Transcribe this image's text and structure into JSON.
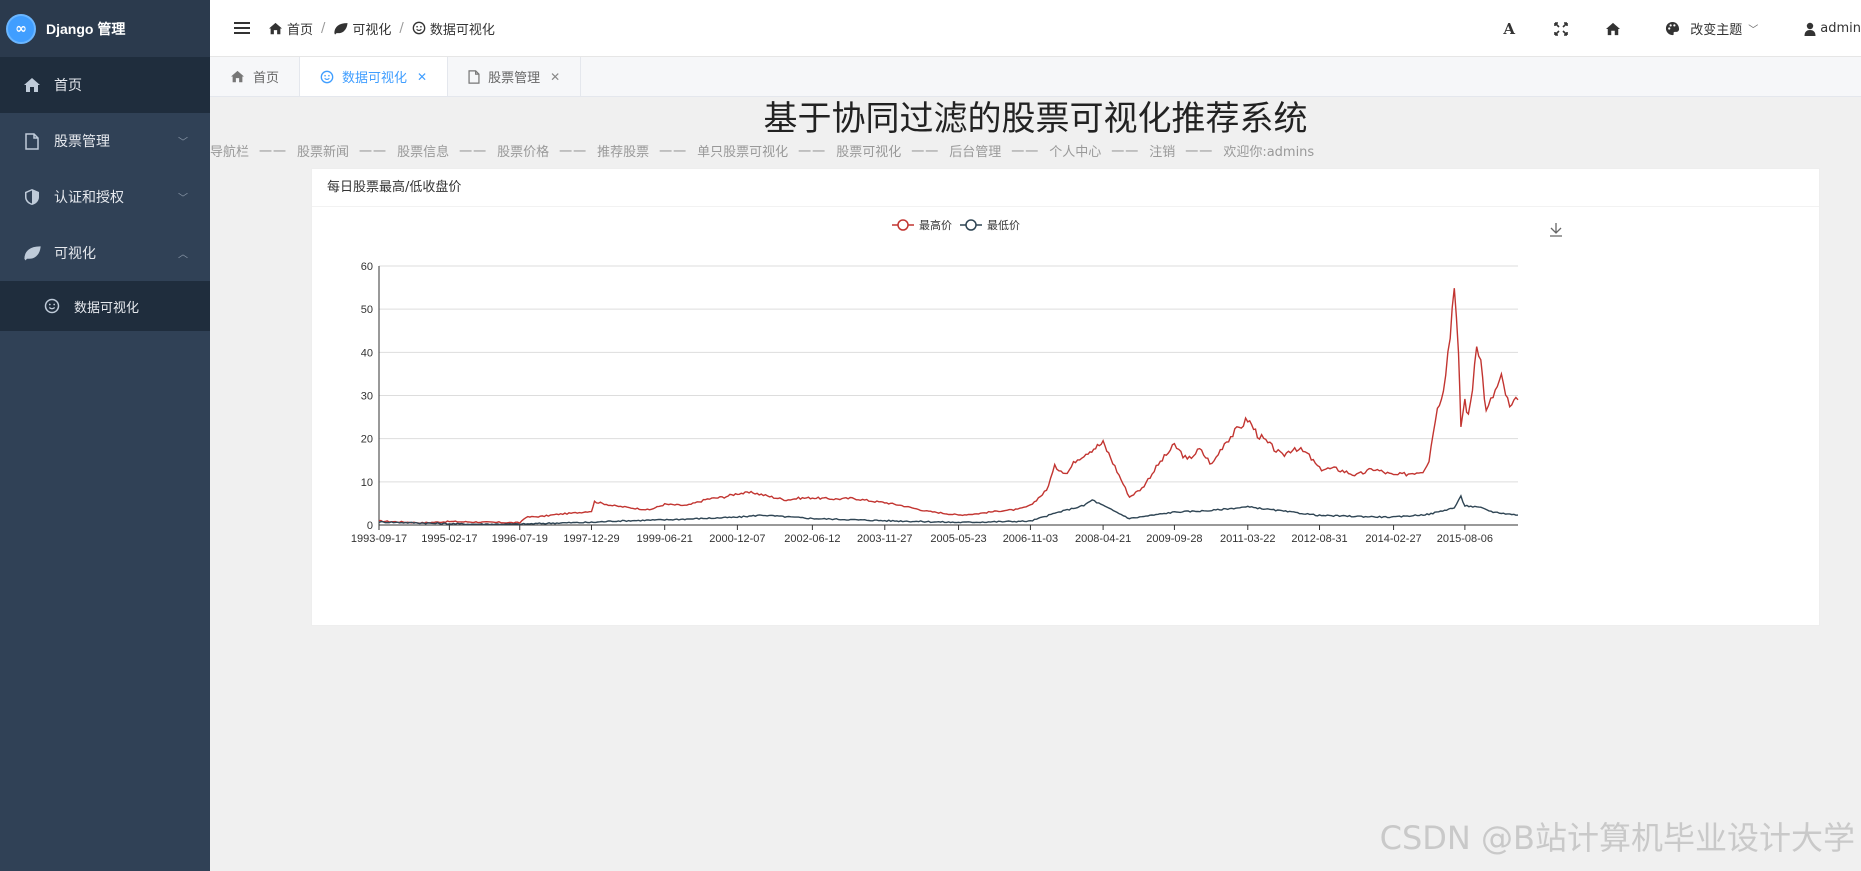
{
  "app": {
    "brand_title": "Django 管理",
    "logo_icon": "infinity-logo-icon"
  },
  "sidebar": {
    "items": [
      {
        "label": "首页",
        "icon": "home-icon"
      },
      {
        "label": "股票管理",
        "icon": "file-icon"
      },
      {
        "label": "认证和授权",
        "icon": "shield-icon"
      },
      {
        "label": "可视化",
        "icon": "leaf-icon"
      }
    ],
    "subitems": [
      {
        "label": "数据可视化",
        "icon": "smile-icon"
      }
    ]
  },
  "header": {
    "breadcrumb": [
      {
        "label": "首页",
        "icon": "home-icon"
      },
      {
        "label": "可视化",
        "icon": "leaf-icon"
      },
      {
        "label": "数据可视化",
        "icon": "smile-icon"
      }
    ],
    "theme_label": "改变主题",
    "user_label": "admin"
  },
  "tabs": [
    {
      "label": "首页",
      "icon": "home-icon"
    },
    {
      "label": "数据可视化",
      "icon": "smile-icon",
      "active": true
    },
    {
      "label": "股票管理",
      "icon": "file-icon"
    }
  ],
  "page": {
    "title": "基于协同过滤的股票可视化推荐系统",
    "nav_links": [
      "导航栏",
      "股票新闻",
      "股票信息",
      "股票价格",
      "推荐股票",
      "单只股票可视化",
      "股票可视化",
      "后台管理",
      "个人中心",
      "注销",
      "欢迎你:admins"
    ],
    "nav_separator": "一一",
    "card_title": "每日股票最高/低收盘价",
    "watermark": "CSDN @B站计算机毕业设计大学"
  },
  "chart_data": {
    "type": "line",
    "title": "",
    "xlabel": "",
    "ylabel": "",
    "ylim": [
      0,
      60
    ],
    "yticks": [
      0,
      10,
      20,
      30,
      40,
      50,
      60
    ],
    "grid": true,
    "legend_position": "top-center",
    "x_tick_labels": [
      "1993-09-17",
      "1995-02-17",
      "1996-07-19",
      "1997-12-29",
      "1999-06-21",
      "2000-12-07",
      "2002-06-12",
      "2003-11-27",
      "2005-05-23",
      "2006-11-03",
      "2008-04-21",
      "2009-09-28",
      "2011-03-22",
      "2012-08-31",
      "2014-02-27",
      "2015-08-06"
    ],
    "x_range": [
      "1993-09-17",
      "2016-08-31"
    ],
    "series": [
      {
        "name": "最高价",
        "color": "#c23531",
        "points": [
          [
            "1993-09-17",
            0.9
          ],
          [
            "1994-03-01",
            0.7
          ],
          [
            "1994-08-01",
            0.5
          ],
          [
            "1995-02-17",
            0.8
          ],
          [
            "1995-08-01",
            0.7
          ],
          [
            "1996-02-01",
            0.6
          ],
          [
            "1996-07-19",
            0.5
          ],
          [
            "1996-09-01",
            1.8
          ],
          [
            "1997-01-01",
            2.0
          ],
          [
            "1997-05-01",
            2.5
          ],
          [
            "1997-09-01",
            2.8
          ],
          [
            "1997-12-29",
            3.2
          ],
          [
            "1998-01-20",
            5.4
          ],
          [
            "1998-06-01",
            4.5
          ],
          [
            "1998-12-01",
            3.8
          ],
          [
            "1999-03-01",
            3.5
          ],
          [
            "1999-06-21",
            4.8
          ],
          [
            "1999-12-01",
            4.5
          ],
          [
            "2000-05-01",
            6.0
          ],
          [
            "2000-09-01",
            6.5
          ],
          [
            "2000-12-07",
            7.3
          ],
          [
            "2001-04-01",
            7.5
          ],
          [
            "2001-08-01",
            6.6
          ],
          [
            "2001-12-01",
            5.8
          ],
          [
            "2002-03-01",
            6.2
          ],
          [
            "2002-06-12",
            6.3
          ],
          [
            "2002-12-01",
            6.0
          ],
          [
            "2003-04-01",
            6.2
          ],
          [
            "2003-09-01",
            5.5
          ],
          [
            "2003-11-27",
            5.2
          ],
          [
            "2004-04-01",
            4.5
          ],
          [
            "2004-10-01",
            3.2
          ],
          [
            "2005-05-23",
            2.3
          ],
          [
            "2005-10-01",
            2.6
          ],
          [
            "2006-03-01",
            3.2
          ],
          [
            "2006-08-01",
            3.6
          ],
          [
            "2006-11-03",
            4.5
          ],
          [
            "2007-03-01",
            8.0
          ],
          [
            "2007-05-01",
            13.5
          ],
          [
            "2007-08-01",
            12.0
          ],
          [
            "2007-10-01",
            15.0
          ],
          [
            "2008-01-01",
            17.0
          ],
          [
            "2008-04-21",
            19.0
          ],
          [
            "2008-06-01",
            16.5
          ],
          [
            "2008-09-01",
            10.5
          ],
          [
            "2008-11-01",
            6.5
          ],
          [
            "2009-02-01",
            8.5
          ],
          [
            "2009-06-01",
            14.0
          ],
          [
            "2009-09-28",
            18.5
          ],
          [
            "2010-01-01",
            15.0
          ],
          [
            "2010-04-01",
            17.5
          ],
          [
            "2010-07-01",
            14.0
          ],
          [
            "2010-10-01",
            19.0
          ],
          [
            "2011-01-01",
            22.0
          ],
          [
            "2011-03-22",
            24.5
          ],
          [
            "2011-06-01",
            21.0
          ],
          [
            "2011-09-01",
            18.5
          ],
          [
            "2011-12-01",
            16.0
          ],
          [
            "2012-03-01",
            18.0
          ],
          [
            "2012-06-01",
            16.5
          ],
          [
            "2012-08-31",
            13.0
          ],
          [
            "2013-01-01",
            13.0
          ],
          [
            "2013-06-01",
            11.5
          ],
          [
            "2013-10-01",
            13.0
          ],
          [
            "2014-02-27",
            11.5
          ],
          [
            "2014-06-01",
            11.8
          ],
          [
            "2014-10-01",
            12.5
          ],
          [
            "2014-11-15",
            15.0
          ],
          [
            "2015-01-01",
            25.0
          ],
          [
            "2015-03-01",
            32.0
          ],
          [
            "2015-04-20",
            44.0
          ],
          [
            "2015-05-20",
            57.0
          ],
          [
            "2015-06-20",
            39.0
          ],
          [
            "2015-07-08",
            23.0
          ],
          [
            "2015-08-06",
            29.0
          ],
          [
            "2015-09-01",
            25.0
          ],
          [
            "2015-10-01",
            32.0
          ],
          [
            "2015-11-01",
            43.0
          ],
          [
            "2015-12-01",
            38.0
          ],
          [
            "2016-01-10",
            26.0
          ],
          [
            "2016-03-01",
            30.0
          ],
          [
            "2016-05-01",
            34.0
          ],
          [
            "2016-07-01",
            27.0
          ],
          [
            "2016-08-31",
            29.0
          ]
        ]
      },
      {
        "name": "最低价",
        "color": "#2f4554",
        "points": [
          [
            "1993-09-17",
            0.7
          ],
          [
            "1994-06-01",
            0.5
          ],
          [
            "1995-02-17",
            0.3
          ],
          [
            "1995-08-01",
            0.2
          ],
          [
            "1996-07-19",
            0.2
          ],
          [
            "1997-06-01",
            0.5
          ],
          [
            "1997-12-29",
            0.6
          ],
          [
            "1998-06-01",
            0.9
          ],
          [
            "1999-06-21",
            1.2
          ],
          [
            "2000-12-07",
            1.8
          ],
          [
            "2001-06-01",
            2.3
          ],
          [
            "2002-06-12",
            1.5
          ],
          [
            "2003-11-27",
            1.0
          ],
          [
            "2005-05-23",
            0.6
          ],
          [
            "2006-11-03",
            0.9
          ],
          [
            "2007-06-01",
            3.0
          ],
          [
            "2007-12-01",
            4.5
          ],
          [
            "2008-02-01",
            5.8
          ],
          [
            "2008-04-21",
            4.5
          ],
          [
            "2008-11-01",
            1.5
          ],
          [
            "2009-09-28",
            3.0
          ],
          [
            "2010-06-01",
            3.3
          ],
          [
            "2011-03-22",
            4.2
          ],
          [
            "2012-08-31",
            2.2
          ],
          [
            "2014-02-27",
            1.8
          ],
          [
            "2014-11-15",
            2.5
          ],
          [
            "2015-05-20",
            4.0
          ],
          [
            "2015-07-08",
            6.5
          ],
          [
            "2015-08-06",
            4.5
          ],
          [
            "2015-12-01",
            4.0
          ],
          [
            "2016-03-01",
            3.0
          ],
          [
            "2016-08-31",
            2.3
          ]
        ]
      }
    ]
  }
}
